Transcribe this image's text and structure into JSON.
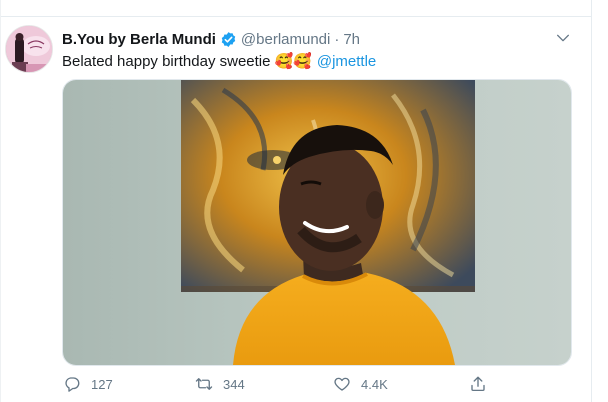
{
  "tweet": {
    "author_name": "B.You by Berla Mundi",
    "handle": "@berlamundi",
    "separator": "·",
    "time": "7h",
    "text": "Belated happy birthday sweetie",
    "emojis": "🥰🥰",
    "mention": "@jmettle"
  },
  "actions": {
    "reply_count": "127",
    "retweet_count": "344",
    "like_count": "4.4K"
  },
  "colors": {
    "verified": "#1da1f2",
    "mention": "#1b95e0",
    "muted": "#657786",
    "sweater": "#f2a619"
  },
  "icons": [
    "verified-badge-icon",
    "chevron-down-icon",
    "reply-icon",
    "retweet-icon",
    "like-icon",
    "share-icon"
  ]
}
